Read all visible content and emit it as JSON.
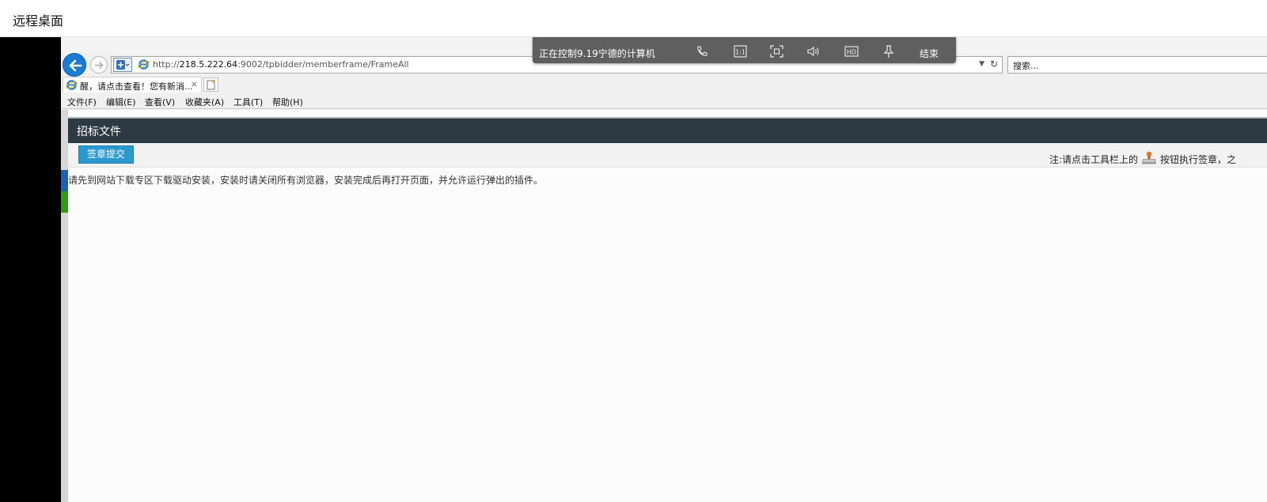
{
  "window": {
    "title": "远程桌面"
  },
  "remote_toolbar": {
    "status": "正在控制9.19宁德的计算机",
    "icons": [
      "phone-icon",
      "one-to-one-icon",
      "fullscreen-icon",
      "volume-icon",
      "hd-icon",
      "pin-icon"
    ],
    "end_label": "结束"
  },
  "browser": {
    "url_prefix": "http://",
    "url_host": "218.5.222.64",
    "url_rest": ":9002/tpbidder/memberframe/FrameAll",
    "search_placeholder": "搜索...",
    "tab_title": "醒，请点击查看！您有新消...",
    "tab_close": "×",
    "menu": [
      "文件(F)",
      "编辑(E)",
      "查看(V)",
      "收藏夹(A)",
      "工具(T)",
      "帮助(H)"
    ]
  },
  "page": {
    "panel_title": "招标文件",
    "sign_button": "签章提交",
    "note_prefix": "注:请点击工具栏上的",
    "note_suffix": "按钮执行签章，之",
    "notice": "请先到网站下载专区下载驱动安装，安装时请关闭所有浏览器，安装完成后再打开页面，并允许运行弹出的插件。"
  }
}
